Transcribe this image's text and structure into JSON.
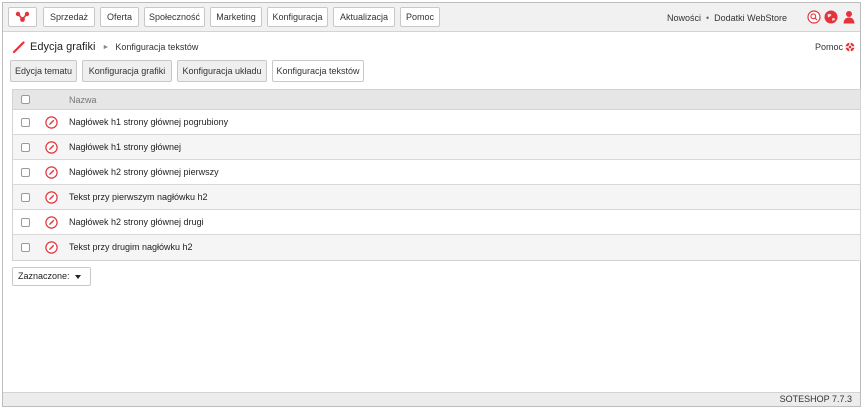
{
  "nav": {
    "items": [
      "Sprzedaż",
      "Oferta",
      "Społeczność",
      "Marketing",
      "Konfiguracja",
      "Aktualizacja",
      "Pomoc"
    ],
    "links": [
      "Nowości",
      "Dodatki WebStore"
    ],
    "separator": "•",
    "icons": [
      "search-icon",
      "globe-icon",
      "user-icon"
    ]
  },
  "breadcrumb": {
    "title": "Edycja grafiki",
    "separator": "►",
    "current": "Konfiguracja tekstów"
  },
  "help": {
    "label": "Pomoc"
  },
  "tabs": [
    {
      "label": "Edycja tematu",
      "active": false
    },
    {
      "label": "Konfiguracja grafiki",
      "active": false
    },
    {
      "label": "Konfiguracja układu",
      "active": false
    },
    {
      "label": "Konfiguracja tekstów",
      "active": true
    }
  ],
  "table": {
    "header": {
      "name": "Nazwa"
    },
    "rows": [
      {
        "name": "Nagłówek h1 strony głównej pogrubiony"
      },
      {
        "name": "Nagłówek h1 strony głównej"
      },
      {
        "name": "Nagłówek h2 strony głównej pierwszy"
      },
      {
        "name": "Tekst przy pierwszym nagłówku h2"
      },
      {
        "name": "Nagłówek h2 strony głównej drugi"
      },
      {
        "name": "Tekst przy drugim nagłówku h2"
      }
    ]
  },
  "bulk": {
    "label": "Zaznaczone:"
  },
  "footer": {
    "version": "SOTESHOP 7.7.3"
  },
  "colors": {
    "accent": "#e3343b",
    "header_bg": "#f1f1f1",
    "table_head_bg": "#e6e6e6"
  }
}
